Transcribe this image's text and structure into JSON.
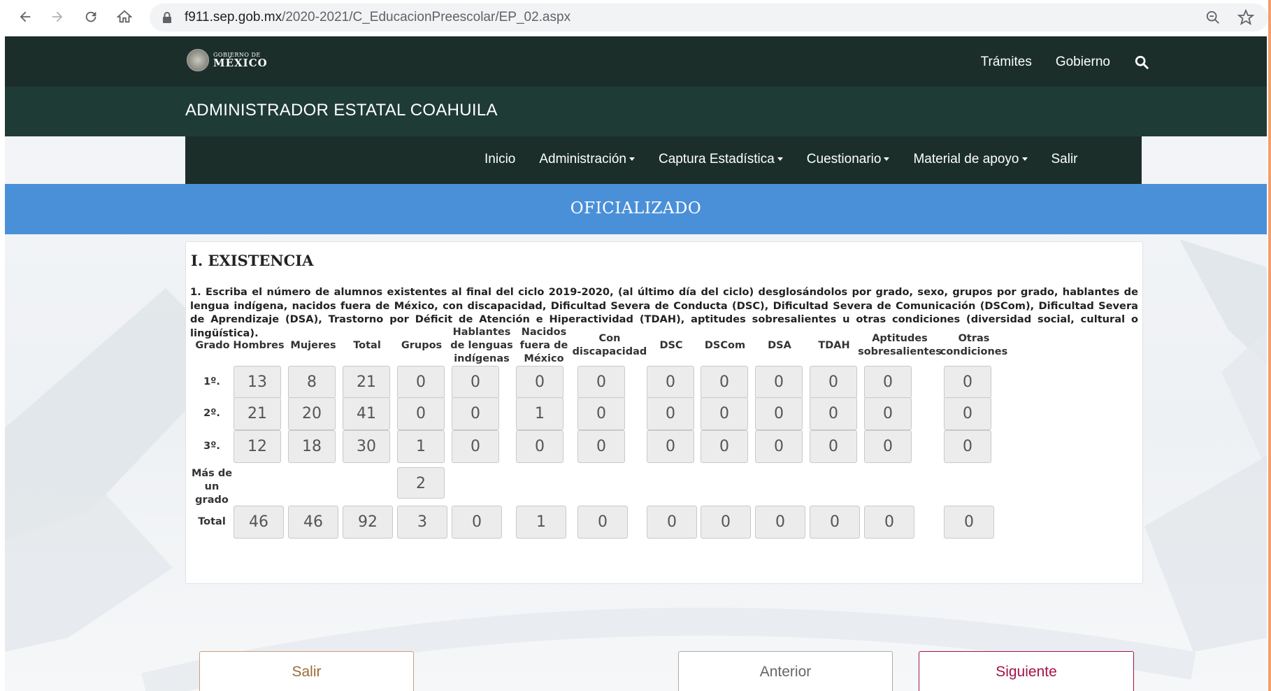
{
  "browser": {
    "url_host": "f911.sep.gob.mx",
    "url_path": "/2020-2021/C_EducacionPreescolar/EP_02.aspx"
  },
  "header": {
    "logo_small": "GOBIERNO DE",
    "logo_big": "MÉXICO",
    "links": [
      "Trámites",
      "Gobierno"
    ]
  },
  "subheader": {
    "title": "ADMINISTRADOR ESTATAL COAHUILA"
  },
  "menu": {
    "items": [
      {
        "label": "Inicio",
        "dropdown": false
      },
      {
        "label": "Administración",
        "dropdown": true
      },
      {
        "label": "Captura Estadística",
        "dropdown": true
      },
      {
        "label": "Cuestionario",
        "dropdown": true
      },
      {
        "label": "Material de apoyo",
        "dropdown": true
      },
      {
        "label": "Salir",
        "dropdown": false
      }
    ]
  },
  "status": {
    "text": "OFICIALIZADO"
  },
  "section": {
    "title": "I. EXISTENCIA",
    "instructions": "1. Escriba el número de alumnos existentes al final del ciclo 2019-2020, (al último día del ciclo) desglosándolos por grado, sexo, grupos por grado, hablantes de lengua indígena, nacidos fuera de México, con discapacidad, Dificultad Severa de Conducta (DSC), Dificultad Severa de Comunicación (DSCom), Dificultad Severa de Aprendizaje (DSA), Trastorno por Déficit de Atención e Hiperactividad (TDAH), aptitudes sobresalientes u otras condiciones (diversidad social, cultural o lingüística)."
  },
  "table": {
    "columns": [
      "Grado",
      "Hombres",
      "Mujeres",
      "Total",
      "Grupos",
      "Hablantes de lenguas indígenas",
      "Nacidos fuera de México",
      "Con discapacidad",
      "DSC",
      "DSCom",
      "DSA",
      "TDAH",
      "Aptitudes sobresalientes",
      "Otras condiciones"
    ],
    "rows": [
      {
        "label": "1º.",
        "values": [
          "13",
          "8",
          "21",
          "0",
          "0",
          "0",
          "0",
          "0",
          "0",
          "0",
          "0",
          "0",
          "0"
        ]
      },
      {
        "label": "2º.",
        "values": [
          "21",
          "20",
          "41",
          "0",
          "0",
          "1",
          "0",
          "0",
          "0",
          "0",
          "0",
          "0",
          "0"
        ]
      },
      {
        "label": "3º.",
        "values": [
          "12",
          "18",
          "30",
          "1",
          "0",
          "0",
          "0",
          "0",
          "0",
          "0",
          "0",
          "0",
          "0"
        ]
      },
      {
        "label": "Más de un grado",
        "values": [
          null,
          null,
          null,
          "2",
          null,
          null,
          null,
          null,
          null,
          null,
          null,
          null,
          null
        ]
      },
      {
        "label": "Total",
        "values": [
          "46",
          "46",
          "92",
          "3",
          "0",
          "1",
          "0",
          "0",
          "0",
          "0",
          "0",
          "0",
          "0"
        ]
      }
    ]
  },
  "buttons": {
    "salir": "Salir",
    "anterior": "Anterior",
    "siguiente": "Siguiente"
  }
}
